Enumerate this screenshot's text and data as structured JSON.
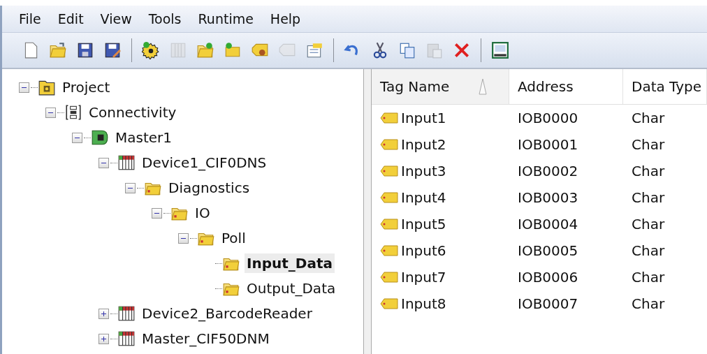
{
  "menu": [
    "File",
    "Edit",
    "View",
    "Tools",
    "Runtime",
    "Help"
  ],
  "toolbar": [
    [
      {
        "kind": "new",
        "disabled": false
      },
      {
        "kind": "open",
        "disabled": false
      },
      {
        "kind": "save",
        "disabled": false
      },
      {
        "kind": "save-as",
        "disabled": false
      }
    ],
    [
      {
        "kind": "gear-add",
        "disabled": false
      },
      {
        "kind": "columns",
        "disabled": true
      },
      {
        "kind": "folder-add",
        "disabled": false
      },
      {
        "kind": "folder-add-small",
        "disabled": false
      },
      {
        "kind": "tag-gear",
        "disabled": false
      },
      {
        "kind": "tags",
        "disabled": true
      },
      {
        "kind": "properties",
        "disabled": false
      }
    ],
    [
      {
        "kind": "undo",
        "disabled": false
      },
      {
        "kind": "cut",
        "disabled": false
      },
      {
        "kind": "copy",
        "disabled": false
      },
      {
        "kind": "paste",
        "disabled": true
      },
      {
        "kind": "delete",
        "disabled": false
      }
    ],
    [
      {
        "kind": "qc",
        "disabled": false
      }
    ]
  ],
  "tree": [
    {
      "label": "Project",
      "kind": "project",
      "expanded": true,
      "selected": false,
      "children": [
        {
          "label": "Connectivity",
          "kind": "connectivity",
          "expanded": true,
          "selected": false,
          "children": [
            {
              "label": "Master1",
              "kind": "card",
              "expanded": true,
              "selected": false,
              "children": [
                {
                  "label": "Device1_CIF0DNS",
                  "kind": "device",
                  "expanded": true,
                  "selected": false,
                  "children": [
                    {
                      "label": "Diagnostics",
                      "kind": "folder",
                      "expanded": true,
                      "selected": false,
                      "children": [
                        {
                          "label": "IO",
                          "kind": "folder",
                          "expanded": true,
                          "selected": false,
                          "children": [
                            {
                              "label": "Poll",
                              "kind": "folder",
                              "expanded": true,
                              "selected": false,
                              "children": [
                                {
                                  "label": "Input_Data",
                                  "kind": "folder",
                                  "selected": true
                                },
                                {
                                  "label": "Output_Data",
                                  "kind": "folder",
                                  "selected": false
                                }
                              ]
                            }
                          ]
                        }
                      ]
                    }
                  ]
                },
                {
                  "label": "Device2_BarcodeReader",
                  "kind": "device",
                  "expanded": false,
                  "selected": false
                },
                {
                  "label": "Master_CIF50DNM",
                  "kind": "device",
                  "expanded": false,
                  "selected": false
                }
              ]
            }
          ]
        }
      ]
    }
  ],
  "table": {
    "columns": [
      {
        "label": "Tag Name",
        "sorted": true
      },
      {
        "label": "Address",
        "sorted": false
      },
      {
        "label": "Data Type",
        "sorted": false
      }
    ],
    "rows": [
      {
        "tag_name": "Input1",
        "address": "IOB0000",
        "data_type": "Char"
      },
      {
        "tag_name": "Input2",
        "address": "IOB0001",
        "data_type": "Char"
      },
      {
        "tag_name": "Input3",
        "address": "IOB0002",
        "data_type": "Char"
      },
      {
        "tag_name": "Input4",
        "address": "IOB0003",
        "data_type": "Char"
      },
      {
        "tag_name": "Input5",
        "address": "IOB0004",
        "data_type": "Char"
      },
      {
        "tag_name": "Input6",
        "address": "IOB0005",
        "data_type": "Char"
      },
      {
        "tag_name": "Input7",
        "address": "IOB0006",
        "data_type": "Char"
      },
      {
        "tag_name": "Input8",
        "address": "IOB0007",
        "data_type": "Char"
      }
    ]
  }
}
